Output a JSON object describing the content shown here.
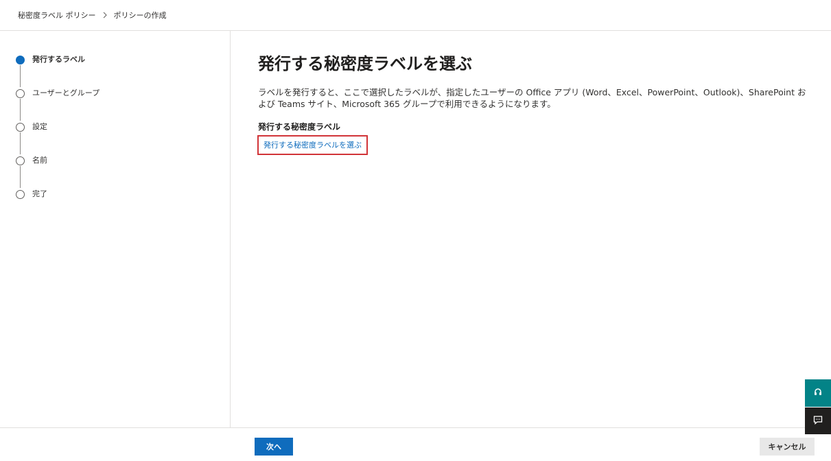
{
  "breadcrumb": {
    "items": [
      "秘密度ラベル ポリシー",
      "ポリシーの作成"
    ]
  },
  "steps": [
    {
      "label": "発行するラベル",
      "active": true
    },
    {
      "label": "ユーザーとグループ",
      "active": false
    },
    {
      "label": "設定",
      "active": false
    },
    {
      "label": "名前",
      "active": false
    },
    {
      "label": "完了",
      "active": false
    }
  ],
  "main": {
    "title": "発行する秘密度ラベルを選ぶ",
    "description": "ラベルを発行すると、ここで選択したラベルが、指定したユーザーの Office アプリ (Word、Excel、PowerPoint、Outlook)、SharePoint および Teams サイト、Microsoft 365 グループで利用できるようになります。",
    "section_label": "発行する秘密度ラベル",
    "choose_link": "発行する秘密度ラベルを選ぶ"
  },
  "footer": {
    "next_label": "次へ",
    "cancel_label": "キャンセル"
  },
  "colors": {
    "accent": "#0f6cbd",
    "highlight_border": "#d13438",
    "help_tab": "#038387",
    "feedback_tab": "#201f1e"
  },
  "icons": {
    "breadcrumb_separator": "chevron-right-icon",
    "help_tab": "headset-icon",
    "feedback_tab": "feedback-icon"
  }
}
